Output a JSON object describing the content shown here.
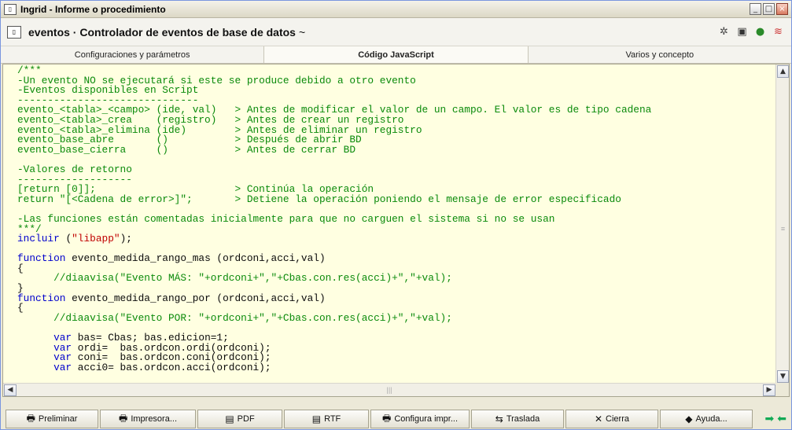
{
  "window": {
    "title": "Ingrid - Informe o procedimiento"
  },
  "header": {
    "title": "eventos · Controlador de eventos de base de datos",
    "suffix": "~"
  },
  "tabs": [
    {
      "label": "Configuraciones y parámetros"
    },
    {
      "label": "Código JavaScript"
    },
    {
      "label": "Varios y concepto"
    }
  ],
  "code_lines": [
    "/***",
    "-Un evento NO se ejecutará si este se produce debido a otro evento",
    "-Eventos disponibles en Script",
    "------------------------------",
    "evento_<tabla>_<campo> (ide, val)   > Antes de modificar el valor de un campo. El valor es de tipo cadena",
    "evento_<tabla>_crea    (registro)   > Antes de crear un registro",
    "evento_<tabla>_elimina (ide)        > Antes de eliminar un registro",
    "evento_base_abre       ()           > Después de abrir BD",
    "evento_base_cierra     ()           > Antes de cerrar BD",
    "",
    "-Valores de retorno",
    "-------------------",
    "[return [0]];                       > Continúa la operación",
    "return \"[<Cadena de error>]\";       > Detiene la operación poniendo el mensaje de error especificado",
    "",
    "-Las funciones están comentadas inicialmente para que no carguen el sistema si no se usan",
    "***/",
    "incluir (\"libapp\");",
    "",
    "function evento_medida_rango_mas (ordconi,acci,val)",
    "{",
    "      //diaavisa(\"Evento MÁS: \"+ordconi+\",\"+Cbas.con.res(acci)+\",\"+val);",
    "}",
    "function evento_medida_rango_por (ordconi,acci,val)",
    "{",
    "      //diaavisa(\"Evento POR: \"+ordconi+\",\"+Cbas.con.res(acci)+\",\"+val);",
    "",
    "      var bas= Cbas; bas.edicion=1;",
    "      var ordi=  bas.ordcon.ordi(ordconi);",
    "      var coni=  bas.ordcon.coni(ordconi);",
    "      var acci0= bas.ordcon.acci(ordconi);"
  ],
  "buttons": [
    {
      "label": "Preliminar",
      "icon": "printer-preview-icon"
    },
    {
      "label": "Impresora...",
      "icon": "printer-icon"
    },
    {
      "label": "PDF",
      "icon": "pdf-icon"
    },
    {
      "label": "RTF",
      "icon": "rtf-icon"
    },
    {
      "label": "Configura impr...",
      "icon": "printer-config-icon"
    },
    {
      "label": "Traslada",
      "icon": "move-icon"
    },
    {
      "label": "Cierra",
      "icon": "close-icon"
    },
    {
      "label": "Ayuda...",
      "icon": "help-book-icon"
    }
  ],
  "colors": {
    "editor_bg": "#ffffe1",
    "comment": "#0a8a0a",
    "keyword": "#0000cc",
    "string": "#c00000"
  }
}
